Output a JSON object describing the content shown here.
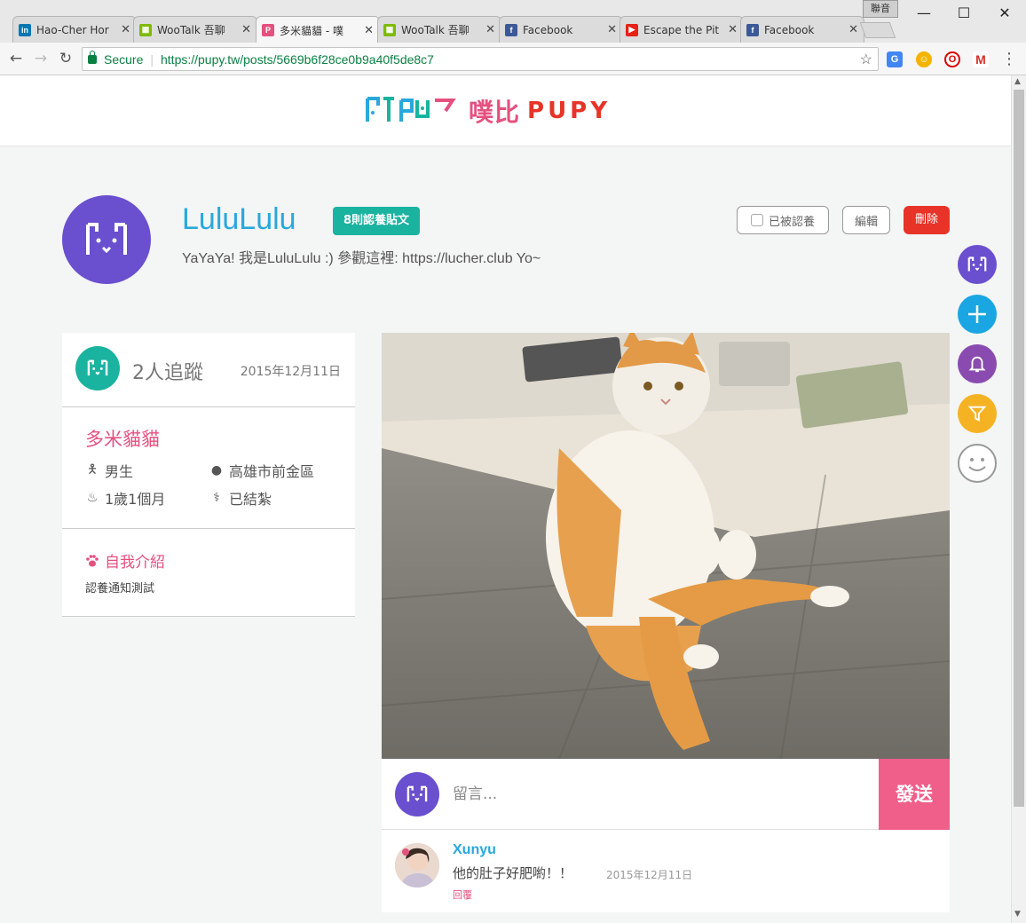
{
  "browser": {
    "tabs": [
      {
        "label": "Hao-Cher Hor",
        "icon": "linkedin-icon",
        "color": "#0077b5",
        "glyph": "in"
      },
      {
        "label": "WooTalk 吾聊",
        "icon": "windows-icon",
        "color": "#f25022",
        "glyph": "▦"
      },
      {
        "label": "多米貓貓 - 噗",
        "icon": "pupy-icon",
        "color": "#e4517f",
        "glyph": "P"
      },
      {
        "label": "WooTalk 吾聊",
        "icon": "windows-icon",
        "color": "#f25022",
        "glyph": "▦"
      },
      {
        "label": "Facebook",
        "icon": "facebook-icon",
        "color": "#3b5998",
        "glyph": "f"
      },
      {
        "label": "Escape the Pit",
        "icon": "youtube-icon",
        "color": "#e62117",
        "glyph": "▶"
      },
      {
        "label": "Facebook",
        "icon": "facebook-icon",
        "color": "#3b5998",
        "glyph": "f"
      }
    ],
    "profile_label": "聯音",
    "secure_label": "Secure",
    "url": "https://pupy.tw/posts/5669b6f28ce0b9a40f5de8c7"
  },
  "header": {
    "logo_cn": "噗比",
    "logo_en": "PUPY"
  },
  "owner": {
    "username": "LuluLulu",
    "post_badge": "8則認養貼文",
    "bio": "YaYaYa! 我是LuluLulu :) 參觀這裡: https://lucher.club Yo~",
    "adopted_label": "已被認養",
    "edit_label": "編輯",
    "delete_label": "刪除"
  },
  "sidecard": {
    "followers": "2人追蹤",
    "date": "2015年12月11日",
    "pet_name": "多米貓貓",
    "gender": "男生",
    "location": "高雄市前金區",
    "age": "1歲1個月",
    "neutered": "已結紮",
    "intro_title": "自我介紹",
    "intro_text": "認養通知測試"
  },
  "comment_bar": {
    "placeholder": "留言...",
    "send_label": "發送"
  },
  "comments": [
    {
      "user": "Xunyu",
      "text": "他的肚子好肥喲！！",
      "date": "2015年12月11日",
      "reply_label": "回覆"
    }
  ],
  "colors": {
    "brand_purple": "#6a4fcf",
    "brand_teal": "#1ab3a0",
    "brand_pink": "#e4517f",
    "brand_blue": "#29a8dc",
    "danger": "#e83328"
  }
}
